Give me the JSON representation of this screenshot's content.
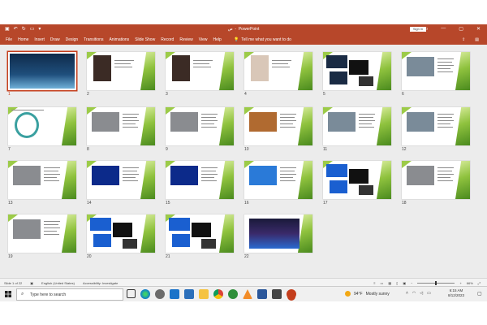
{
  "window": {
    "title": "PowerPoint",
    "filename_glyph": "ص",
    "sign_in": "Sign in",
    "min_icon": "minimize-icon",
    "max_icon": "maximize-icon",
    "close_icon": "close-icon"
  },
  "ribbon": {
    "tabs": [
      "File",
      "Home",
      "Insert",
      "Draw",
      "Design",
      "Transitions",
      "Animations",
      "Slide Show",
      "Record",
      "Review",
      "View",
      "Help"
    ],
    "tell_me": "Tell me what you want to do",
    "accent": "#b7472a"
  },
  "slides": [
    {
      "n": "1"
    },
    {
      "n": "2"
    },
    {
      "n": "3"
    },
    {
      "n": "4"
    },
    {
      "n": "5"
    },
    {
      "n": "6"
    },
    {
      "n": "7"
    },
    {
      "n": "8"
    },
    {
      "n": "9"
    },
    {
      "n": "10"
    },
    {
      "n": "11"
    },
    {
      "n": "12"
    },
    {
      "n": "13"
    },
    {
      "n": "14"
    },
    {
      "n": "15"
    },
    {
      "n": "16"
    },
    {
      "n": "17"
    },
    {
      "n": "18"
    },
    {
      "n": "19"
    },
    {
      "n": "20"
    },
    {
      "n": "21"
    },
    {
      "n": "22"
    }
  ],
  "selected_slide": 1,
  "status": {
    "slide_of": "Slide 1 of 22",
    "language": "English (United States)",
    "accessibility": "Accessibility: Investigate",
    "zoom": "66%"
  },
  "taskbar": {
    "search_placeholder": "Type here to search",
    "weather_temp": "94°F",
    "weather_desc": "Mostly sunny",
    "time": "6:15 AM",
    "date": "8/12/2023"
  }
}
